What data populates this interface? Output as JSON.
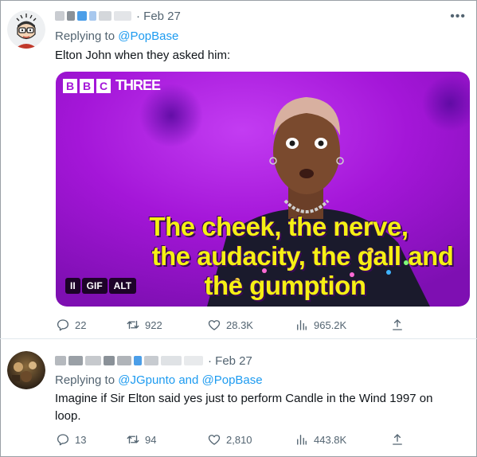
{
  "tweets": [
    {
      "date": "· Feb 27",
      "reply_prefix": "Replying to ",
      "reply_mentions": "@PopBase",
      "text": "Elton John when they asked him:",
      "media": {
        "logo": "BBC THREE",
        "caption_line1": "The cheek, the nerve,",
        "caption_line2": "the audacity, the gall and",
        "caption_line3": "the gumption",
        "badges": [
          "II",
          "GIF",
          "ALT"
        ]
      },
      "stats": {
        "replies": "22",
        "retweets": "922",
        "likes": "28.3K",
        "views": "965.2K"
      }
    },
    {
      "date": "· Feb 27",
      "reply_prefix": "Replying to ",
      "reply_mentions": "@JGpunto and @PopBase",
      "text": "Imagine if Sir Elton said yes just to perform Candle in the Wind 1997 on loop.",
      "stats": {
        "replies": "13",
        "retweets": "94",
        "likes": "2,810",
        "views": "443.8K"
      }
    }
  ],
  "icons": {
    "reply": "reply-icon",
    "retweet": "retweet-icon",
    "like": "like-icon",
    "views": "views-icon",
    "share": "share-icon",
    "more": "more-icon"
  },
  "colors": {
    "link": "#1d9bf0",
    "secondary_text": "#536471",
    "caption_yellow": "#f6f014",
    "media_magenta": "#b01be0"
  }
}
